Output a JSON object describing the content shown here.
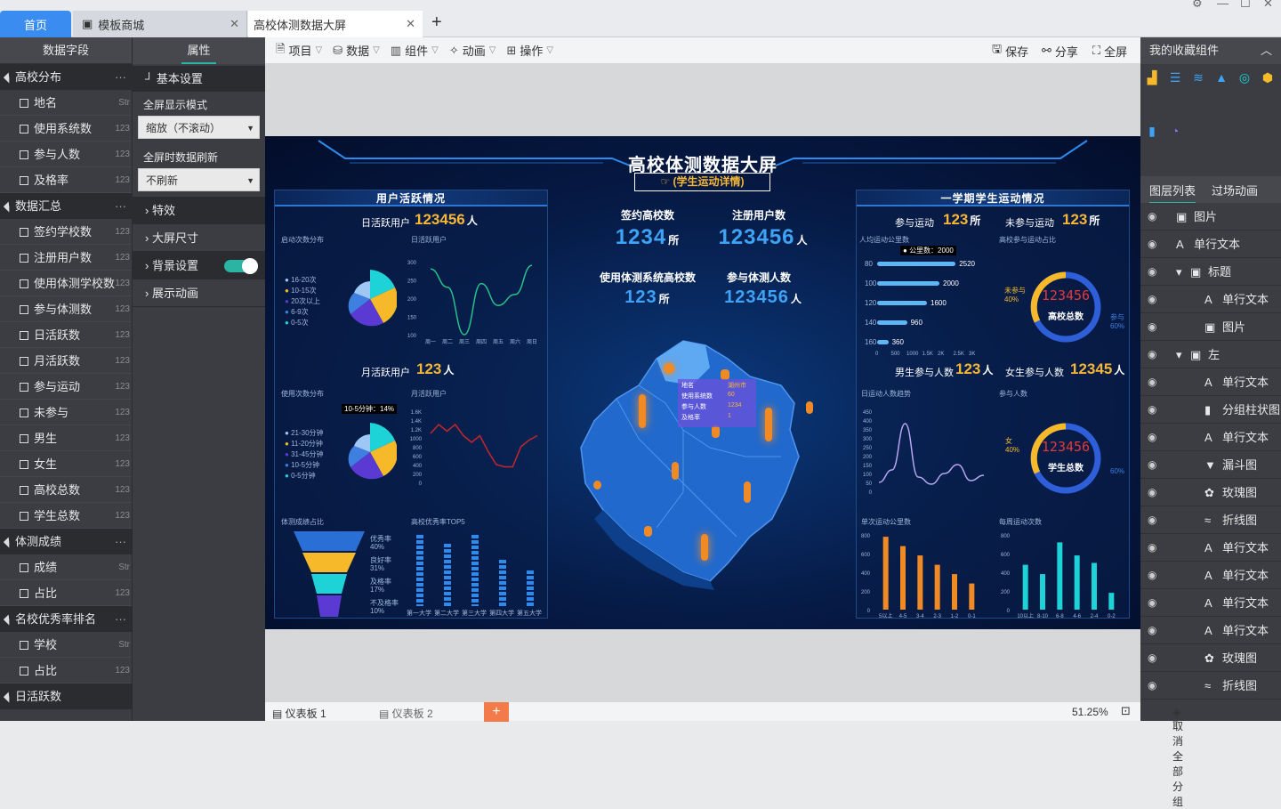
{
  "tabs": {
    "home": "首页",
    "store": "模板商城",
    "active": "高校体测数据大屏"
  },
  "fields": {
    "header": "数据字段",
    "groups": [
      {
        "name": "高校分布",
        "items": [
          [
            "地名",
            "Str"
          ],
          [
            "使用系统数",
            "123"
          ],
          [
            "参与人数",
            "123"
          ],
          [
            "及格率",
            "123"
          ]
        ]
      },
      {
        "name": "数据汇总",
        "items": [
          [
            "签约学校数",
            "123"
          ],
          [
            "注册用户数",
            "123"
          ],
          [
            "使用体测学校数",
            "123"
          ],
          [
            "参与体测数",
            "123"
          ],
          [
            "日活跃数",
            "123"
          ],
          [
            "月活跃数",
            "123"
          ],
          [
            "参与运动",
            "123"
          ],
          [
            "未参与",
            "123"
          ],
          [
            "男生",
            "123"
          ],
          [
            "女生",
            "123"
          ],
          [
            "高校总数",
            "123"
          ],
          [
            "学生总数",
            "123"
          ]
        ]
      },
      {
        "name": "体测成绩",
        "items": [
          [
            "成绩",
            "Str"
          ],
          [
            "占比",
            "123"
          ]
        ]
      },
      {
        "name": "名校优秀率排名",
        "items": [
          [
            "学校",
            "Str"
          ],
          [
            "占比",
            "123"
          ]
        ]
      },
      {
        "name": "日活跃数",
        "items": []
      }
    ]
  },
  "props": {
    "header": "属性",
    "basic": "基本设置",
    "fullscreen_label": "全屏显示模式",
    "fullscreen_value": "缩放（不滚动）",
    "refresh_label": "全屏时数据刷新",
    "refresh_value": "不刷新",
    "effects": "特效",
    "size": "大屏尺寸",
    "bg": "背景设置",
    "anim": "展示动画"
  },
  "toolbar": {
    "project": "项目",
    "data": "数据",
    "component": "组件",
    "animation": "动画",
    "operate": "操作",
    "save": "保存",
    "share": "分享",
    "full": "全屏"
  },
  "fav": {
    "header": "我的收藏组件"
  },
  "layers": {
    "tab1": "图层列表",
    "tab2": "过场动画",
    "items": [
      {
        "t": "图片",
        "d": 0,
        "i": "▣"
      },
      {
        "t": "单行文本",
        "d": 0,
        "i": "A"
      },
      {
        "t": "标题",
        "d": 1,
        "i": "▣",
        "g": true
      },
      {
        "t": "单行文本",
        "d": 2,
        "i": "A"
      },
      {
        "t": "图片",
        "d": 2,
        "i": "▣"
      },
      {
        "t": "左",
        "d": 1,
        "i": "▣",
        "g": true
      },
      {
        "t": "单行文本",
        "d": 2,
        "i": "A"
      },
      {
        "t": "分组柱状图",
        "d": 2,
        "i": "▮"
      },
      {
        "t": "单行文本",
        "d": 2,
        "i": "A"
      },
      {
        "t": "漏斗图",
        "d": 2,
        "i": "▼"
      },
      {
        "t": "玫瑰图",
        "d": 2,
        "i": "✿"
      },
      {
        "t": "折线图",
        "d": 2,
        "i": "≈"
      },
      {
        "t": "单行文本",
        "d": 2,
        "i": "A"
      },
      {
        "t": "单行文本",
        "d": 2,
        "i": "A"
      },
      {
        "t": "单行文本",
        "d": 2,
        "i": "A"
      },
      {
        "t": "单行文本",
        "d": 2,
        "i": "A"
      },
      {
        "t": "玫瑰图",
        "d": 2,
        "i": "✿"
      },
      {
        "t": "折线图",
        "d": 2,
        "i": "≈"
      }
    ],
    "ungroup": "取消全部分组"
  },
  "bottom": {
    "sheet1": "仪表板 1",
    "sheet2": "仪表板 2",
    "zoom": "51.25%"
  },
  "dash": {
    "title": "高校体测数据大屏",
    "button": "(学生运动详情)",
    "left_title": "用户活跃情况",
    "right_title": "一学期学生运动情况",
    "dau_label": "日活跃用户",
    "dau_value": "123456",
    "dau_unit": "人",
    "mau_label": "月活跃用户",
    "mau_value": "123",
    "mau_unit": "人",
    "start_dist": "启动次数分布",
    "dau_chart": "日活跃用户",
    "use_dist": "使用次数分布",
    "mau_chart": "月活跃用户",
    "funnel_title": "体测成绩占比",
    "top5_title": "高校优秀率TOP5",
    "signed_label": "签约高校数",
    "signed_value": "1234",
    "signed_unit": "所",
    "reg_label": "注册用户数",
    "reg_value": "123456",
    "reg_unit": "人",
    "usesys_label": "使用体测系统高校数",
    "usesys_value": "123",
    "usesys_unit": "所",
    "join_label": "参与体测人数",
    "join_value": "123456",
    "join_unit": "人",
    "sport_label": "参与运动",
    "sport_value": "123",
    "sport_unit": "所",
    "nosport_label": "未参与运动",
    "nosport_value": "123",
    "nosport_unit": "所",
    "avgkm": "人均运动公里数",
    "partratio": "高校参与运动占比",
    "male_label": "男生参与人数",
    "male_value": "123",
    "male_unit": "人",
    "female_label": "女生参与人数",
    "female_value": "12345",
    "female_unit": "人",
    "daytrend": "日运动人数趋势",
    "joincount": "参与人数",
    "single_km": "单次运动公里数",
    "weekly": "每周运动次数",
    "donut1_val": "123456",
    "donut1_lbl": "高校总数",
    "donut2_val": "123456",
    "donut2_lbl": "学生总数",
    "d1_left": "未参与",
    "d1_left_pct": "40%",
    "d1_right": "参与",
    "d1_right_pct": "60%",
    "d2_left": "女",
    "d2_left_pct": "40%",
    "d2_right_pct": "60%",
    "map_tip": [
      [
        "地名",
        "湖州市"
      ],
      [
        "使用系统数",
        "60"
      ],
      [
        "参与人数",
        "1234"
      ],
      [
        "及格率",
        "1"
      ]
    ],
    "legend_start": [
      "16-20次",
      "10-15次",
      "20次以上",
      "6-9次",
      "0-5次"
    ],
    "legend_use": [
      "21-30分钟",
      "11-20分钟",
      "31-45分钟",
      "10-5分钟",
      "0-5分钟"
    ],
    "use_tip": "10-5分钟：14%",
    "km_tip": "公里数：2000",
    "funnel": [
      "优秀率",
      "40%",
      "良好率",
      "31%",
      "及格率",
      "17%",
      "不及格率",
      "10%"
    ],
    "top5": [
      "第一大学",
      "第二大学",
      "第三大学",
      "第四大学",
      "第五大学"
    ],
    "dau_x": [
      "周一",
      "周二",
      "周三",
      "周四",
      "周五",
      "周六",
      "周日"
    ],
    "dau_y": [
      "300",
      "250",
      "200",
      "150",
      "100"
    ],
    "mau_y": [
      "1.6K",
      "1.4K",
      "1.2K",
      "1000",
      "800",
      "600",
      "400",
      "200",
      "0"
    ],
    "km_bars": [
      [
        "80",
        "2520"
      ],
      [
        "100",
        "2000"
      ],
      [
        "120",
        "1600"
      ],
      [
        "140",
        "960"
      ],
      [
        "160",
        "360"
      ]
    ],
    "km_x": [
      "0",
      "500",
      "1000",
      "1.5K",
      "2K",
      "2.5K",
      "3K"
    ],
    "trend_y": [
      "450",
      "400",
      "350",
      "300",
      "250",
      "200",
      "150",
      "100",
      "50",
      "0"
    ],
    "single_x": [
      "5以上",
      "4-5",
      "3-4",
      "2-3",
      "1-2",
      "0-1"
    ],
    "single_y": [
      "800",
      "600",
      "400",
      "200",
      "0"
    ],
    "week_x": [
      "10以上",
      "8-10",
      "6-8",
      "4-6",
      "2-4",
      "0-2"
    ],
    "week_y": [
      "800",
      "600",
      "400",
      "200",
      "0"
    ]
  },
  "chart_data": [
    {
      "type": "line",
      "title": "日活跃用户",
      "categories": [
        "周一",
        "周二",
        "周三",
        "周四",
        "周五",
        "周六",
        "周日"
      ],
      "values": [
        280,
        230,
        100,
        240,
        180,
        210,
        290
      ],
      "ylim": [
        100,
        300
      ]
    },
    {
      "type": "line",
      "title": "月活跃用户",
      "values": [
        1100,
        1300,
        1150,
        1300,
        1050,
        900,
        1050,
        700,
        400,
        350,
        350,
        800,
        950,
        1050
      ],
      "ylim": [
        0,
        1600
      ]
    },
    {
      "type": "bar",
      "title": "单次运动公里数",
      "categories": [
        "5以上",
        "4-5",
        "3-4",
        "2-3",
        "1-2",
        "0-1"
      ],
      "values": [
        780,
        680,
        580,
        480,
        380,
        280
      ],
      "ylim": [
        0,
        800
      ]
    },
    {
      "type": "bar",
      "title": "每周运动次数",
      "categories": [
        "10以上",
        "8-10",
        "6-8",
        "4-6",
        "2-4",
        "0-2"
      ],
      "values": [
        480,
        380,
        720,
        580,
        500,
        180
      ],
      "ylim": [
        0,
        800
      ]
    },
    {
      "type": "bar",
      "title": "人均运动公里数",
      "categories": [
        "80",
        "100",
        "120",
        "140",
        "160"
      ],
      "values": [
        2520,
        2000,
        1600,
        960,
        360
      ],
      "xlim": [
        0,
        3000
      ]
    }
  ]
}
